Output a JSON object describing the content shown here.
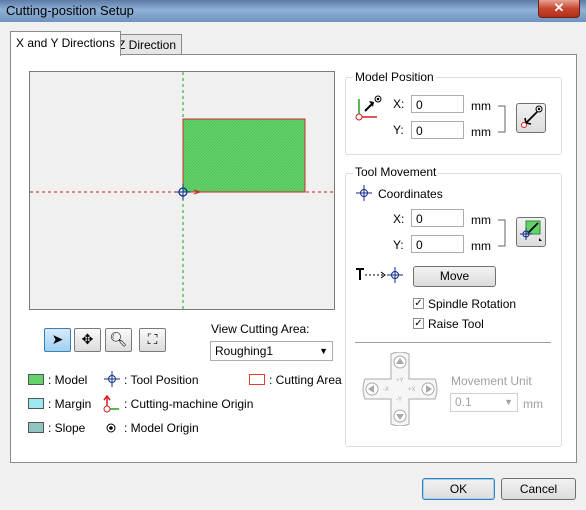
{
  "window": {
    "title": "Cutting-position Setup",
    "close_glyph": "✕"
  },
  "tabs": [
    {
      "label": "X and Y Directions",
      "active": true
    },
    {
      "label": "Z Direction",
      "active": false
    }
  ],
  "view": {
    "label": "View Cutting Area:",
    "selected": "Roughing1",
    "tool_buttons": [
      "pointer-icon",
      "move-icon",
      "zoom-icon",
      "fit-icon"
    ]
  },
  "legend": {
    "model": ": Model",
    "margin": ": Margin",
    "slope": ": Slope",
    "tool_position": ": Tool Position",
    "machine_origin": ": Cutting-machine Origin",
    "model_origin": ": Model Origin",
    "cutting_area": ": Cutting Area"
  },
  "model_position": {
    "title": "Model Position",
    "x_label": "X:",
    "x_value": "0",
    "y_label": "Y:",
    "y_value": "0",
    "unit": "mm"
  },
  "tool_movement": {
    "title": "Tool Movement",
    "coords_label": "Coordinates",
    "x_label": "X:",
    "x_value": "0",
    "y_label": "Y:",
    "y_value": "0",
    "unit": "mm",
    "move_label": "Move",
    "spindle_label": "Spindle Rotation",
    "spindle_checked": true,
    "raise_label": "Raise Tool",
    "raise_checked": true,
    "movement_unit_label": "Movement Unit",
    "movement_unit_value": "0.1",
    "movement_unit_unit": "mm",
    "jog_labels": {
      "plus_y": "+Y",
      "minus_y": "-Y",
      "plus_x": "+X",
      "minus_x": "-X"
    }
  },
  "footer": {
    "ok": "OK",
    "cancel": "Cancel"
  },
  "colors": {
    "model": "#63d26b",
    "margin": "#9ceaf0",
    "slope": "#8fc4c2",
    "cutting_area": "#e53b3b",
    "accent": "#3c7fb1"
  }
}
